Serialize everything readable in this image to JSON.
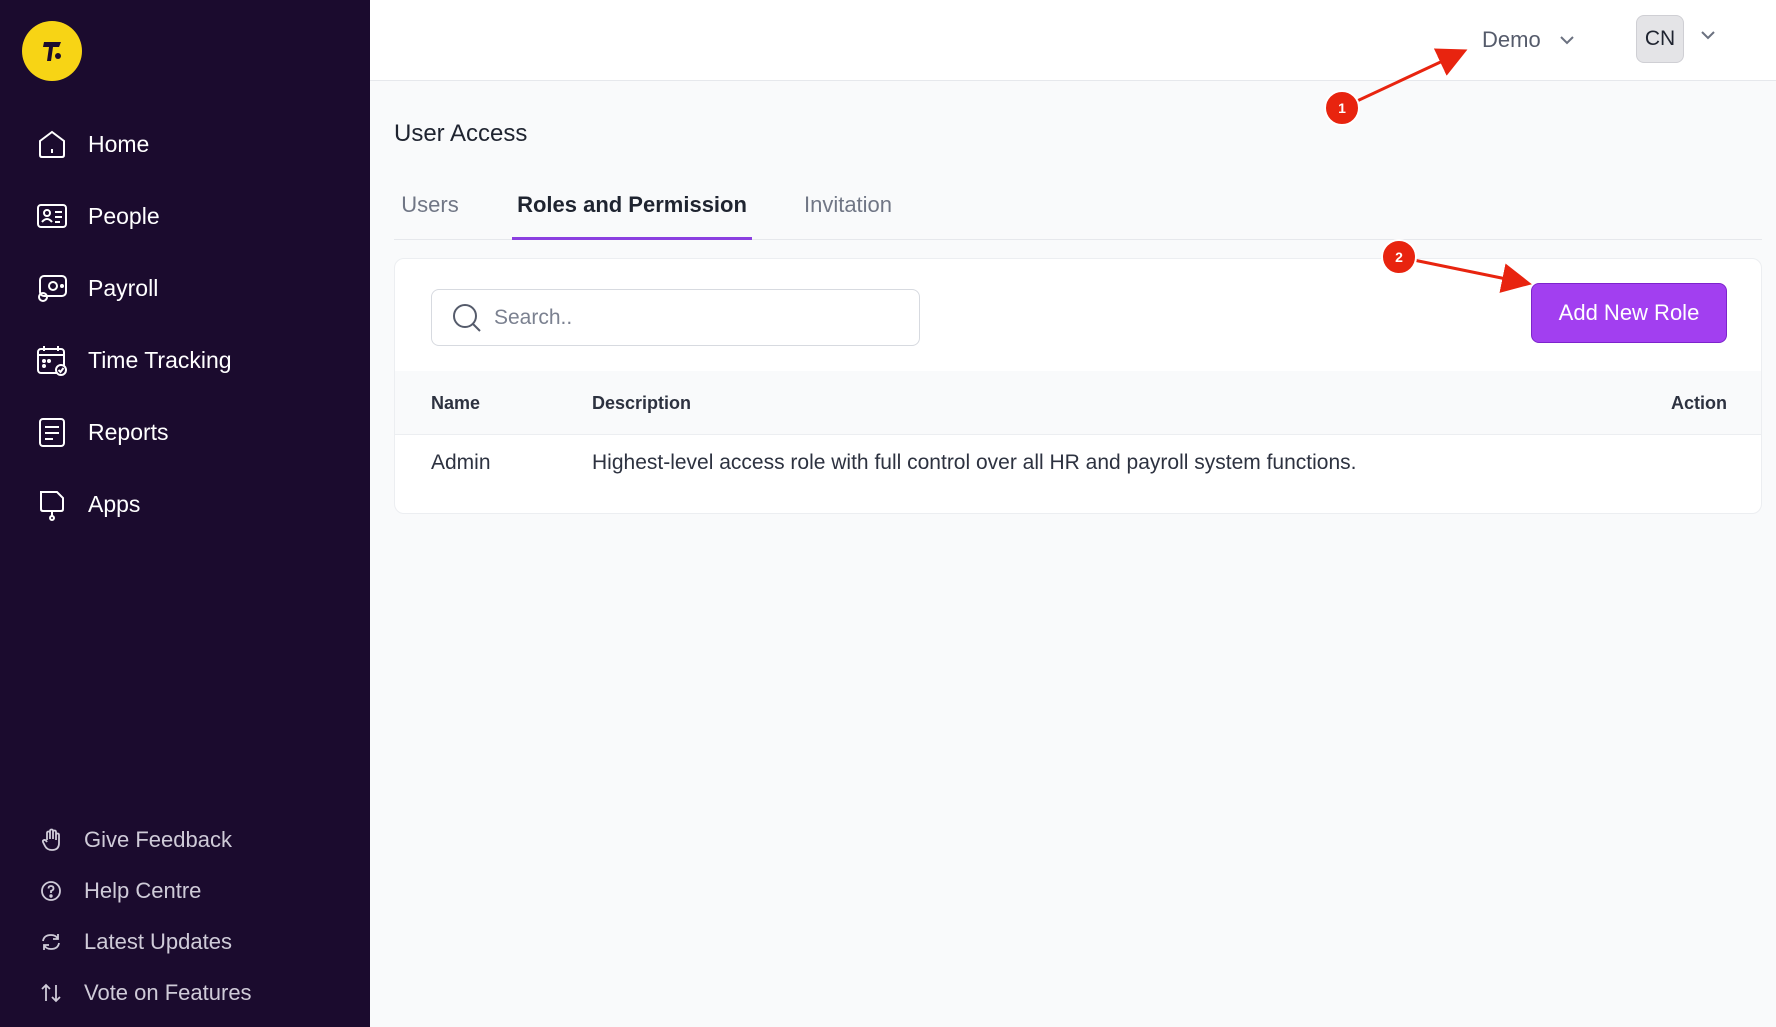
{
  "sidebar": {
    "nav": [
      {
        "label": "Home",
        "icon": "home-icon"
      },
      {
        "label": "People",
        "icon": "id-card-icon"
      },
      {
        "label": "Payroll",
        "icon": "payroll-icon"
      },
      {
        "label": "Time Tracking",
        "icon": "calendar-check-icon"
      },
      {
        "label": "Reports",
        "icon": "report-icon"
      },
      {
        "label": "Apps",
        "icon": "apps-icon"
      }
    ],
    "footer": [
      {
        "label": "Give Feedback",
        "icon": "hand-icon"
      },
      {
        "label": "Help Centre",
        "icon": "help-icon"
      },
      {
        "label": "Latest Updates",
        "icon": "refresh-icon"
      },
      {
        "label": "Vote on Features",
        "icon": "arrows-vote-icon"
      }
    ]
  },
  "header": {
    "company": "Demo",
    "avatar_initials": "CN"
  },
  "page": {
    "title": "User Access",
    "tabs": [
      {
        "label": "Users",
        "active": false
      },
      {
        "label": "Roles and Permission",
        "active": true
      },
      {
        "label": "Invitation",
        "active": false
      }
    ]
  },
  "toolbar": {
    "search_placeholder": "Search..",
    "add_role_label": "Add New Role"
  },
  "table": {
    "columns": [
      "Name",
      "Description",
      "Action"
    ],
    "rows": [
      {
        "name": "Admin",
        "description": "Highest-level access role with full control over all HR and payroll system functions."
      }
    ]
  },
  "annotations": [
    {
      "number": "1"
    },
    {
      "number": "2"
    }
  ],
  "colors": {
    "sidebar_bg": "#1b0b2e",
    "accent": "#a23ff0",
    "tab_underline": "#8b3fe0",
    "logo": "#f7d415",
    "annotation": "#e8240f"
  }
}
